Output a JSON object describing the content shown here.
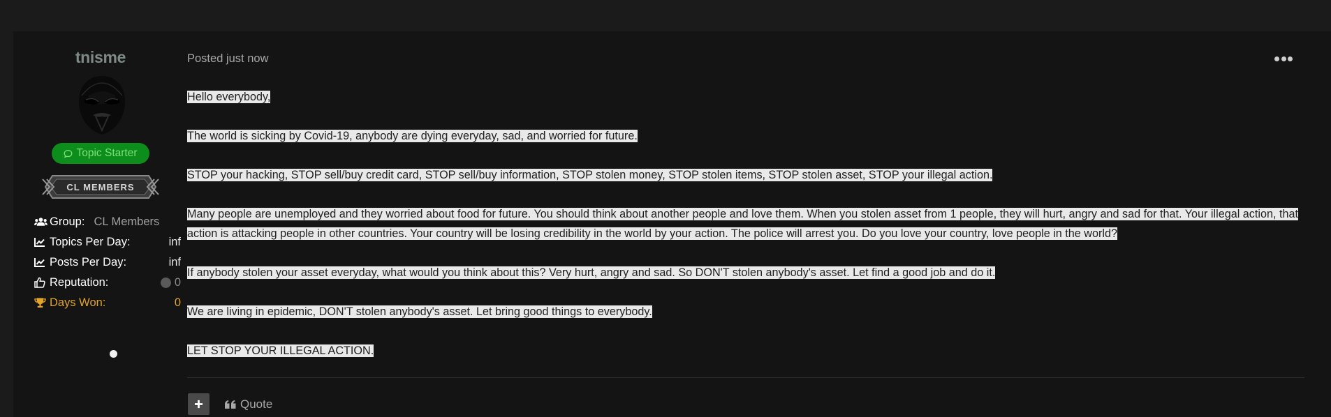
{
  "author": {
    "username": "tnisme",
    "topic_starter_label": "Topic Starter",
    "rank_label": "CL MEMBERS",
    "stats": {
      "group_label": "Group:",
      "group_value": "CL Members",
      "topics_label": "Topics Per Day:",
      "topics_value": "inf",
      "posts_label": "Posts Per Day:",
      "posts_value": "inf",
      "reputation_label": "Reputation:",
      "reputation_value": "0",
      "days_won_label": "Days Won:",
      "days_won_value": "0"
    }
  },
  "post": {
    "meta": "Posted just now",
    "paragraphs": [
      "Hello everybody,",
      "The world is sicking by Covid-19, anybody are dying everyday, sad, and worried for future.",
      "STOP your hacking, STOP sell/buy credit card, STOP sell/buy information, STOP stolen money, STOP stolen items, STOP stolen asset, STOP your illegal action.",
      "Many people are unemployed and they worried about food for future. You should think about another people and love them. When you stolen asset from 1 people, they will hurt, angry and sad for that. Your illegal action, that action is attacking people in other countries. Your country will be losing credibility in the world by your action. The police will arrest you. Do you love your country, love people in the world?",
      "If anybody stolen your asset everyday, what would you think about this? Very hurt, angry and sad. So DON'T stolen anybody's asset. Let find a good job and do it.",
      "We are living in epidemic, DON'T stolen anybody's asset. Let bring good things to everybody.",
      "LET STOP YOUR ILLEGAL ACTION."
    ],
    "actions": {
      "quote_label": "Quote"
    }
  },
  "colors": {
    "page_bg": "#1b1b1b",
    "post_bg": "#141414",
    "username": "#7e8b85",
    "topic_starter_bg": "#0c8d1c",
    "days_won": "#e2a42a",
    "highlight_bg": "#e9e9e9"
  },
  "icons": [
    "users-icon",
    "chart-line-icon",
    "chart-line-icon",
    "thumbs-up-icon",
    "trophy-icon",
    "comment-icon",
    "ellipsis-icon",
    "plus-icon",
    "quote-icon"
  ]
}
